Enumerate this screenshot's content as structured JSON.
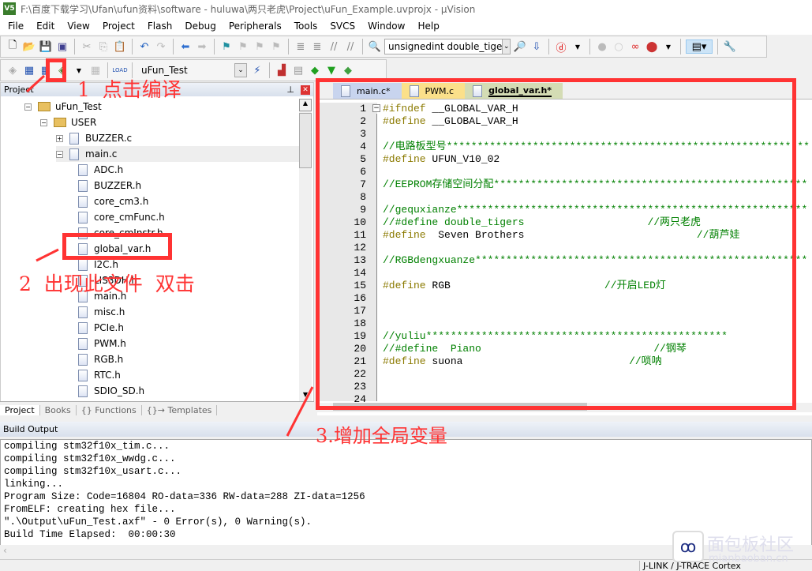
{
  "window": {
    "title": "F:\\百度下载学习\\Ufan\\ufun资料\\software - huluwa\\两只老虎\\Project\\uFun_Example.uvprojx - µVision"
  },
  "menu": [
    "File",
    "Edit",
    "View",
    "Project",
    "Flash",
    "Debug",
    "Peripherals",
    "Tools",
    "SVCS",
    "Window",
    "Help"
  ],
  "toolbar": {
    "find_combo": "unsignedint double_tige",
    "target_combo": "uFun_Test"
  },
  "project": {
    "title": "Project",
    "root": "uFun_Test",
    "group": "USER",
    "files": [
      "BUZZER.c",
      "main.c"
    ],
    "headers": [
      "ADC.h",
      "BUZZER.h",
      "core_cm3.h",
      "core_cmFunc.h",
      "core_cmInstr.h",
      "global_var.h",
      "I2C.h",
      "LIS3DH.h",
      "main.h",
      "misc.h",
      "PCIe.h",
      "PWM.h",
      "RGB.h",
      "RTC.h",
      "SDIO_SD.h"
    ],
    "tabs": [
      "Project",
      "Books",
      "{} Functions",
      "{}→ Templates"
    ]
  },
  "editor": {
    "tabs": [
      "main.c*",
      "PWM.c",
      "global_var.h*"
    ],
    "active_tab": 2,
    "lines": [
      [
        [
          "kw",
          "#ifndef "
        ],
        [
          "pl",
          "__GLOBAL_VAR_H"
        ]
      ],
      [
        [
          "kw",
          "#define "
        ],
        [
          "pl",
          "__GLOBAL_VAR_H"
        ]
      ],
      [],
      [
        [
          "cm",
          "//电路板型号************************************************************"
        ]
      ],
      [
        [
          "kw",
          "#define "
        ],
        [
          "pl",
          "UFUN_V10_02"
        ]
      ],
      [],
      [
        [
          "cm",
          "//EEPROM存储空间分配******************************************************"
        ]
      ],
      [],
      [
        [
          "cm",
          "//gequxianze**************************************************************"
        ]
      ],
      [
        [
          "cm",
          "//#define double_tigers                    //两只老虎"
        ]
      ],
      [
        [
          "kw",
          "#define  "
        ],
        [
          "pl",
          "Seven Brothers                            "
        ],
        [
          "cm",
          "//葫芦娃"
        ]
      ],
      [],
      [
        [
          "cm",
          "//RGBdengxuanze***********************************************************"
        ]
      ],
      [],
      [
        [
          "kw",
          "#define "
        ],
        [
          "pl",
          "RGB                         "
        ],
        [
          "cm",
          "//开启LED灯"
        ]
      ],
      [],
      [],
      [],
      [
        [
          "cm",
          "//yuliu*************************************************"
        ]
      ],
      [
        [
          "cm",
          "//#define  Piano                            //钢琴"
        ]
      ],
      [
        [
          "kw",
          "#define "
        ],
        [
          "pl",
          "suona                           "
        ],
        [
          "cm",
          "//唢呐"
        ]
      ],
      [],
      [],
      []
    ]
  },
  "build_output": {
    "title": "Build Output",
    "lines": [
      "compiling stm32f10x_tim.c...",
      "compiling stm32f10x_wwdg.c...",
      "compiling stm32f10x_usart.c...",
      "linking...",
      "Program Size: Code=16804 RO-data=336 RW-data=288 ZI-data=1256",
      "FromELF: creating hex file...",
      "\".\\Output\\uFun_Test.axf\" - 0 Error(s), 0 Warning(s).",
      "Build Time Elapsed:  00:00:30"
    ]
  },
  "status": {
    "debugger": "J-LINK / J-TRACE Cortex"
  },
  "annotations": {
    "step1": "1  点击编译",
    "step2": "2  出现此文件  双击",
    "step3": "3.增加全局变量",
    "color": "#ff3333"
  },
  "watermark": {
    "text": "面包板社区",
    "sub": "mianbaoban.cn"
  }
}
